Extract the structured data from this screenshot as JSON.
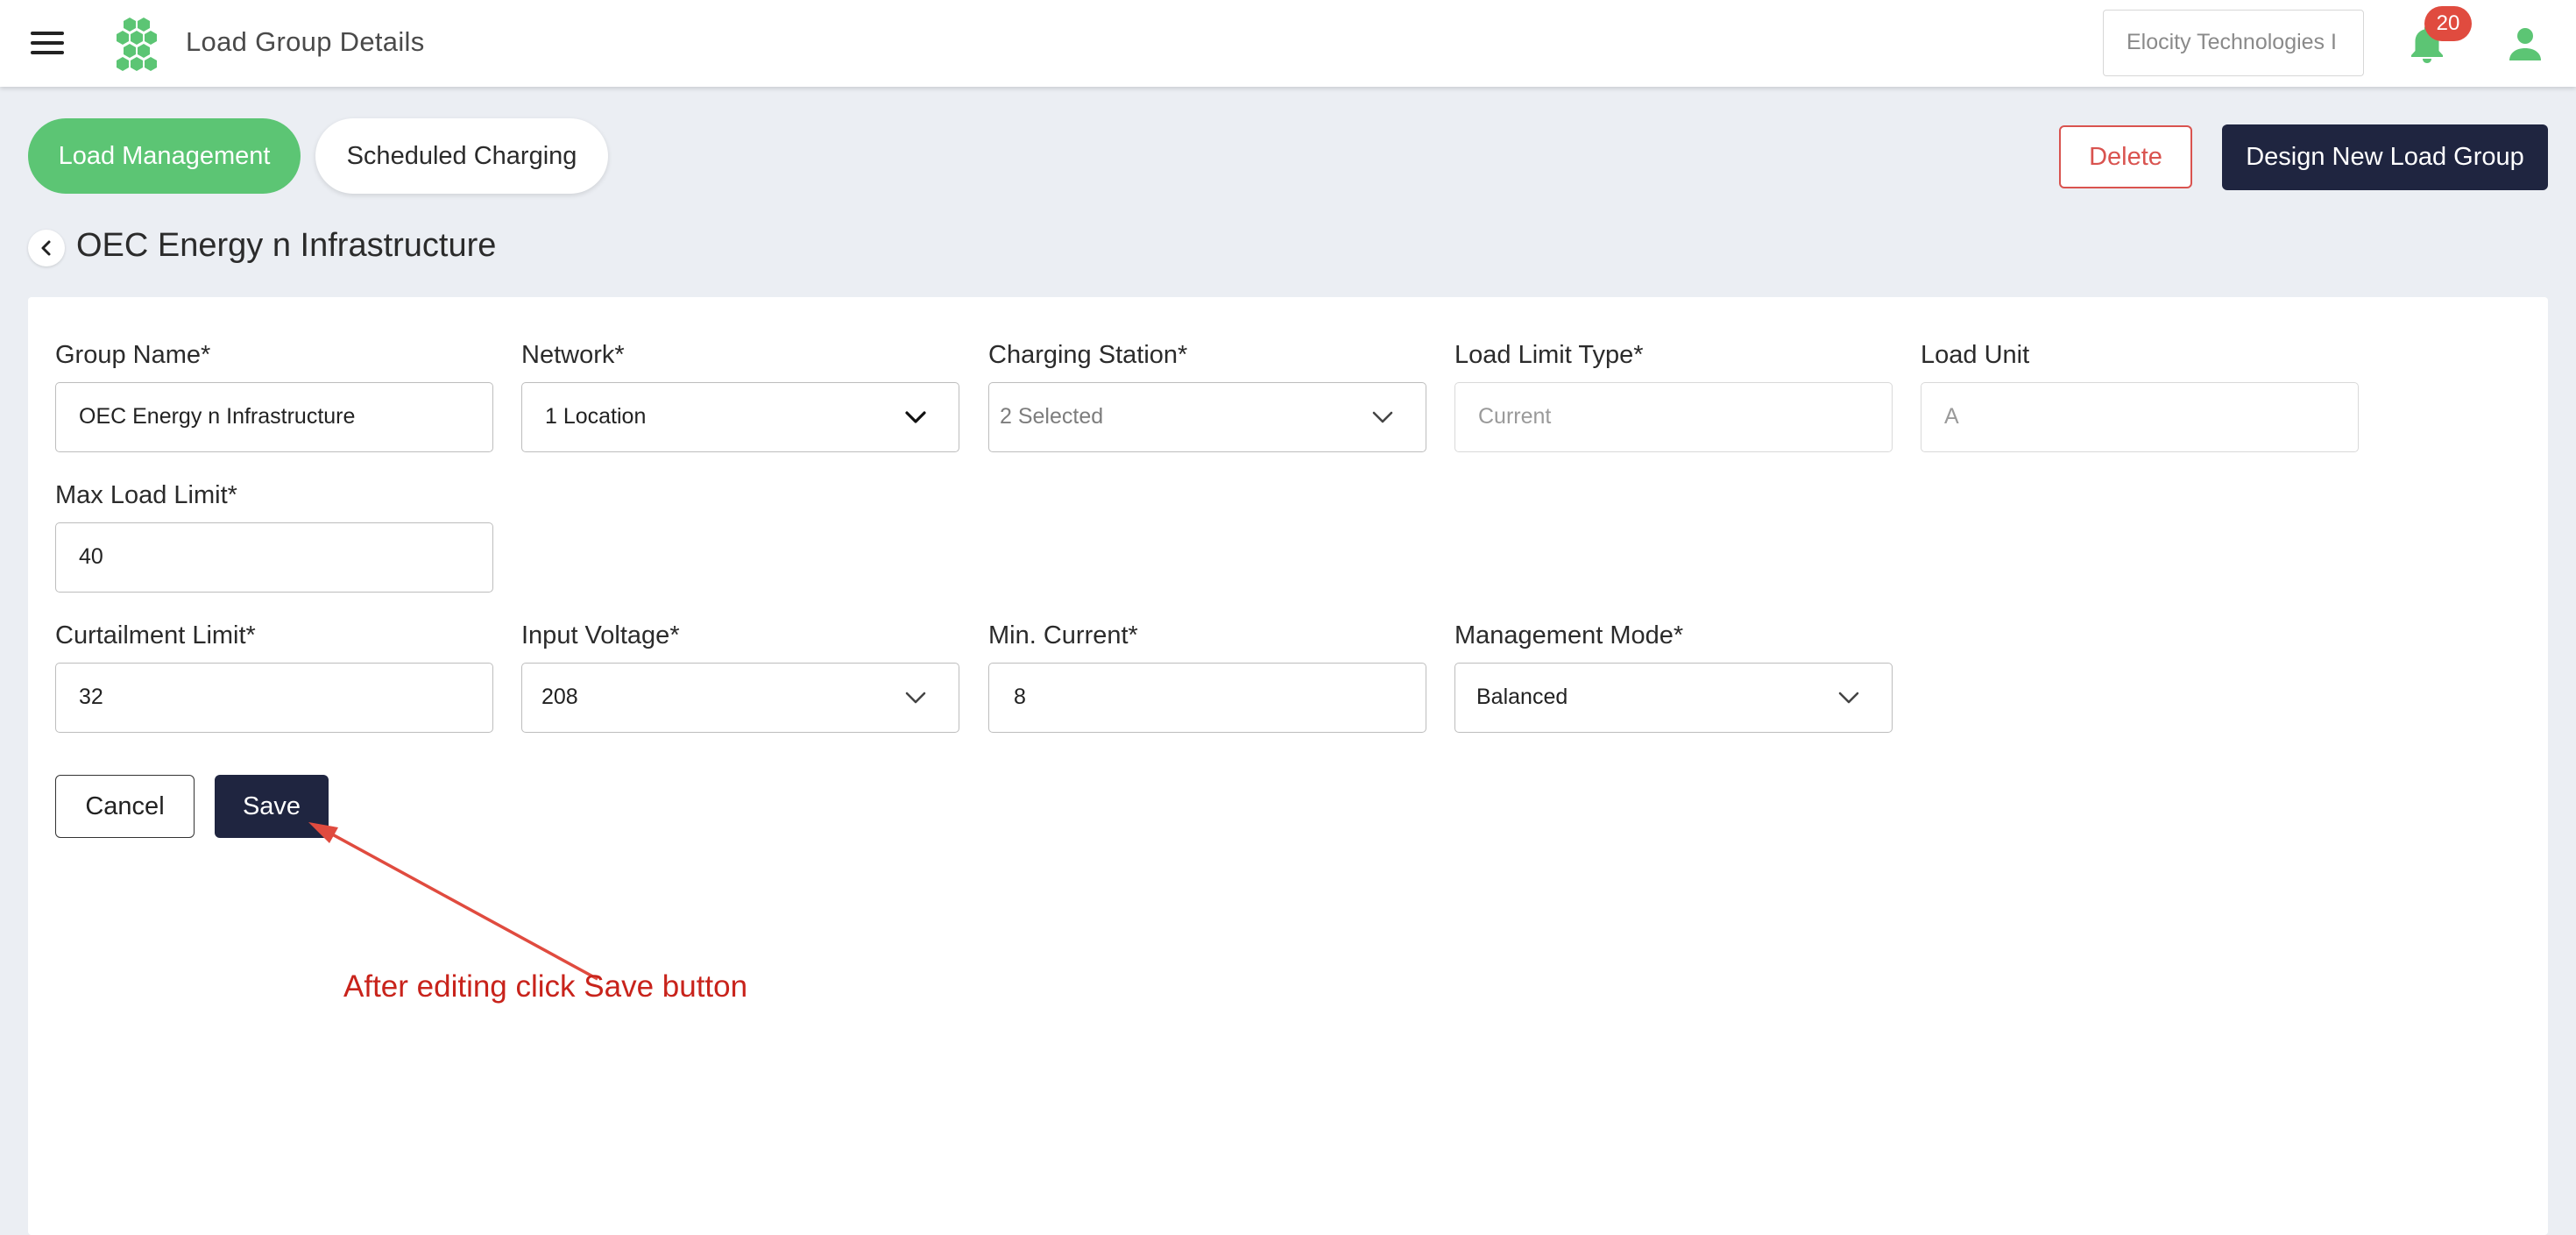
{
  "header": {
    "title": "Load Group Details",
    "organization": "Elocity Technologies I",
    "notification_count": "20",
    "icons": [
      "hamburger-menu-icon",
      "hexagon-logo-icon",
      "bell-icon",
      "user-icon"
    ]
  },
  "tabs": [
    {
      "label": "Load Management",
      "active": true
    },
    {
      "label": "Scheduled Charging",
      "active": false
    }
  ],
  "actions": {
    "delete_label": "Delete",
    "design_label": "Design New Load Group"
  },
  "page": {
    "title": "OEC Energy n Infrastructure"
  },
  "form": {
    "group_name": {
      "label": "Group Name*",
      "value": "OEC Energy n Infrastructure"
    },
    "network": {
      "label": "Network*",
      "value": "1 Location"
    },
    "charging_station": {
      "label": "Charging Station*",
      "value": "2 Selected"
    },
    "load_limit_type": {
      "label": "Load Limit Type*",
      "placeholder": "Current"
    },
    "load_unit": {
      "label": "Load Unit",
      "placeholder": "A"
    },
    "max_load_limit": {
      "label": "Max Load Limit*",
      "value": "40"
    },
    "curtailment_limit": {
      "label": "Curtailment Limit*",
      "value": "32"
    },
    "input_voltage": {
      "label": "Input Voltage*",
      "value": "208"
    },
    "min_current": {
      "label": "Min. Current*",
      "value": "8"
    },
    "management_mode": {
      "label": "Management Mode*",
      "value": "Balanced"
    },
    "cancel_label": "Cancel",
    "save_label": "Save"
  },
  "annotation": {
    "text": "After editing click Save button"
  },
  "colors": {
    "accent_green": "#5cc574",
    "navy": "#1f2540",
    "danger": "#d9534f",
    "annotation_red": "#c8231b",
    "background": "#ebeef3"
  }
}
